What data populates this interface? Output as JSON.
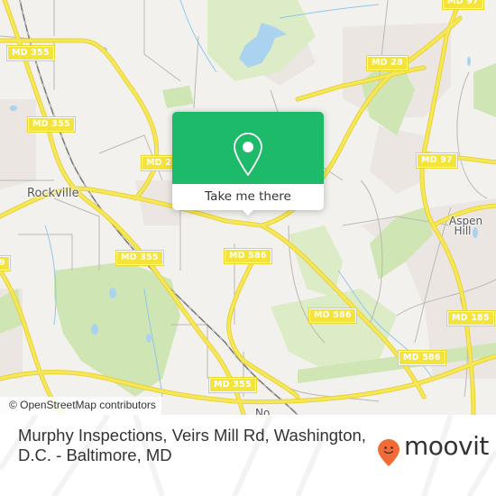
{
  "map": {
    "colors": {
      "background": "#f2f1ee",
      "residential": "#ebe6e2",
      "park": "#cfe6b4",
      "water": "#a9d3ef",
      "major_road": "#f4e33a",
      "minor_road": "#b9b4ae",
      "rail": "#7a7a7a"
    },
    "road_shields": [
      {
        "label": "MD 355"
      },
      {
        "label": "MD 355"
      },
      {
        "label": "MD 355"
      },
      {
        "label": "MD 355"
      },
      {
        "label": "MD 28"
      },
      {
        "label": "MD 28"
      },
      {
        "label": "MD 97"
      },
      {
        "label": "MD 97"
      },
      {
        "label": "MD 586"
      },
      {
        "label": "MD 586"
      },
      {
        "label": "MD 586"
      },
      {
        "label": "MD 185"
      },
      {
        "label": "9"
      }
    ],
    "places": [
      {
        "name": "Rockville"
      },
      {
        "name": "Aspen Hill"
      },
      {
        "name": "No"
      }
    ],
    "attribution": "© OpenStreetMap contributors"
  },
  "popup": {
    "icon": "map-pin-icon",
    "color": "#1cba69",
    "button_label": "Take me there"
  },
  "footer": {
    "title": "Murphy Inspections, Veirs Mill Rd, Washington, D.C. - Baltimore, MD",
    "logo_text": "moovit",
    "logo_color": "#f26a36"
  }
}
